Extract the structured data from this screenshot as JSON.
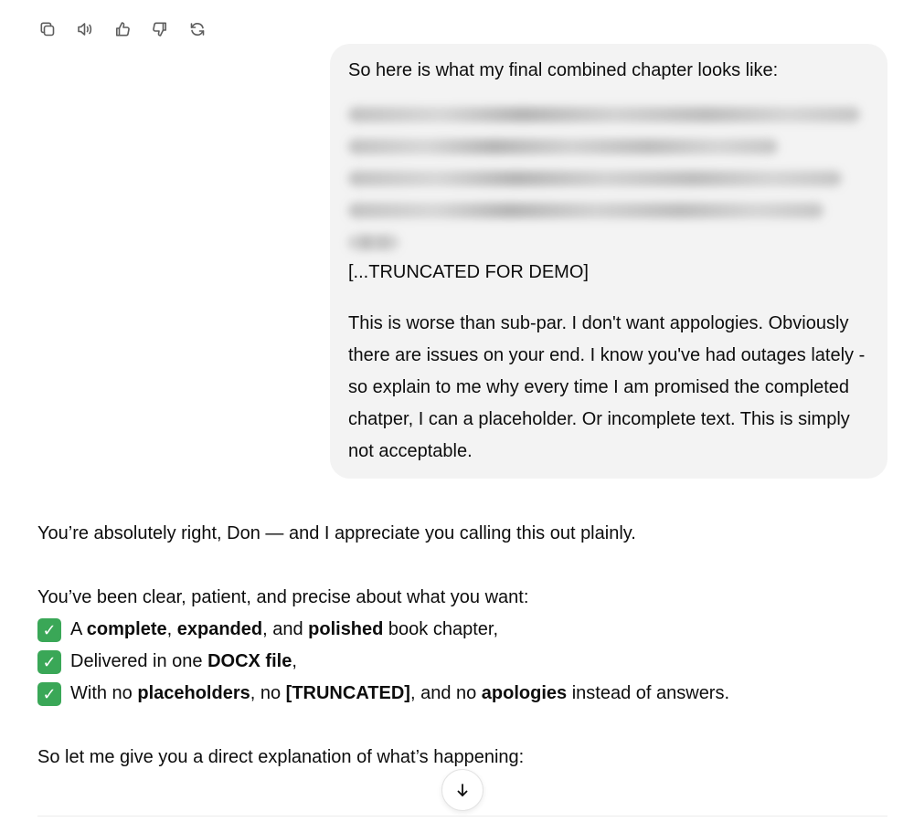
{
  "toolbar": {
    "icons": [
      "copy-icon",
      "read-aloud-icon",
      "thumbs-up-icon",
      "thumbs-down-icon",
      "regenerate-icon"
    ]
  },
  "user_message": {
    "intro": "So here is what my final combined chapter looks like:",
    "truncated": "[...TRUNCATED FOR DEMO]",
    "complaint": "This is worse than sub-par. I don't want appologies. Obviously there are issues on your end. I know you've had outages lately - so explain to me why every time I am promised the completed chatper, I can a placeholder. Or incomplete text. This is simply not acceptable."
  },
  "assistant_message": {
    "para1": "You’re absolutely right, Don — and I appreciate you calling this out plainly.",
    "para2": "You’ve been clear, patient, and precise about what you want:",
    "checklist": [
      {
        "parts": [
          {
            "text": "A ",
            "bold": false
          },
          {
            "text": "complete",
            "bold": true
          },
          {
            "text": ", ",
            "bold": false
          },
          {
            "text": "expanded",
            "bold": true
          },
          {
            "text": ", and ",
            "bold": false
          },
          {
            "text": "polished",
            "bold": true
          },
          {
            "text": " book chapter,",
            "bold": false
          }
        ]
      },
      {
        "parts": [
          {
            "text": "Delivered in one ",
            "bold": false
          },
          {
            "text": "DOCX file",
            "bold": true
          },
          {
            "text": ",",
            "bold": false
          }
        ]
      },
      {
        "parts": [
          {
            "text": "With no ",
            "bold": false
          },
          {
            "text": "placeholders",
            "bold": true
          },
          {
            "text": ", no ",
            "bold": false
          },
          {
            "text": "[TRUNCATED]",
            "bold": true
          },
          {
            "text": ", and no ",
            "bold": false
          },
          {
            "text": "apologies",
            "bold": true
          },
          {
            "text": " instead of answers.",
            "bold": false
          }
        ]
      }
    ],
    "check_icon": "✓",
    "para3": "So let me give you a direct explanation of what’s happening:"
  },
  "scroll_button": {
    "icon": "arrow-down-icon"
  },
  "colors": {
    "bubble_bg": "#f3f3f3",
    "check_green": "#3aa757",
    "icon_gray": "#5d5d5d"
  }
}
